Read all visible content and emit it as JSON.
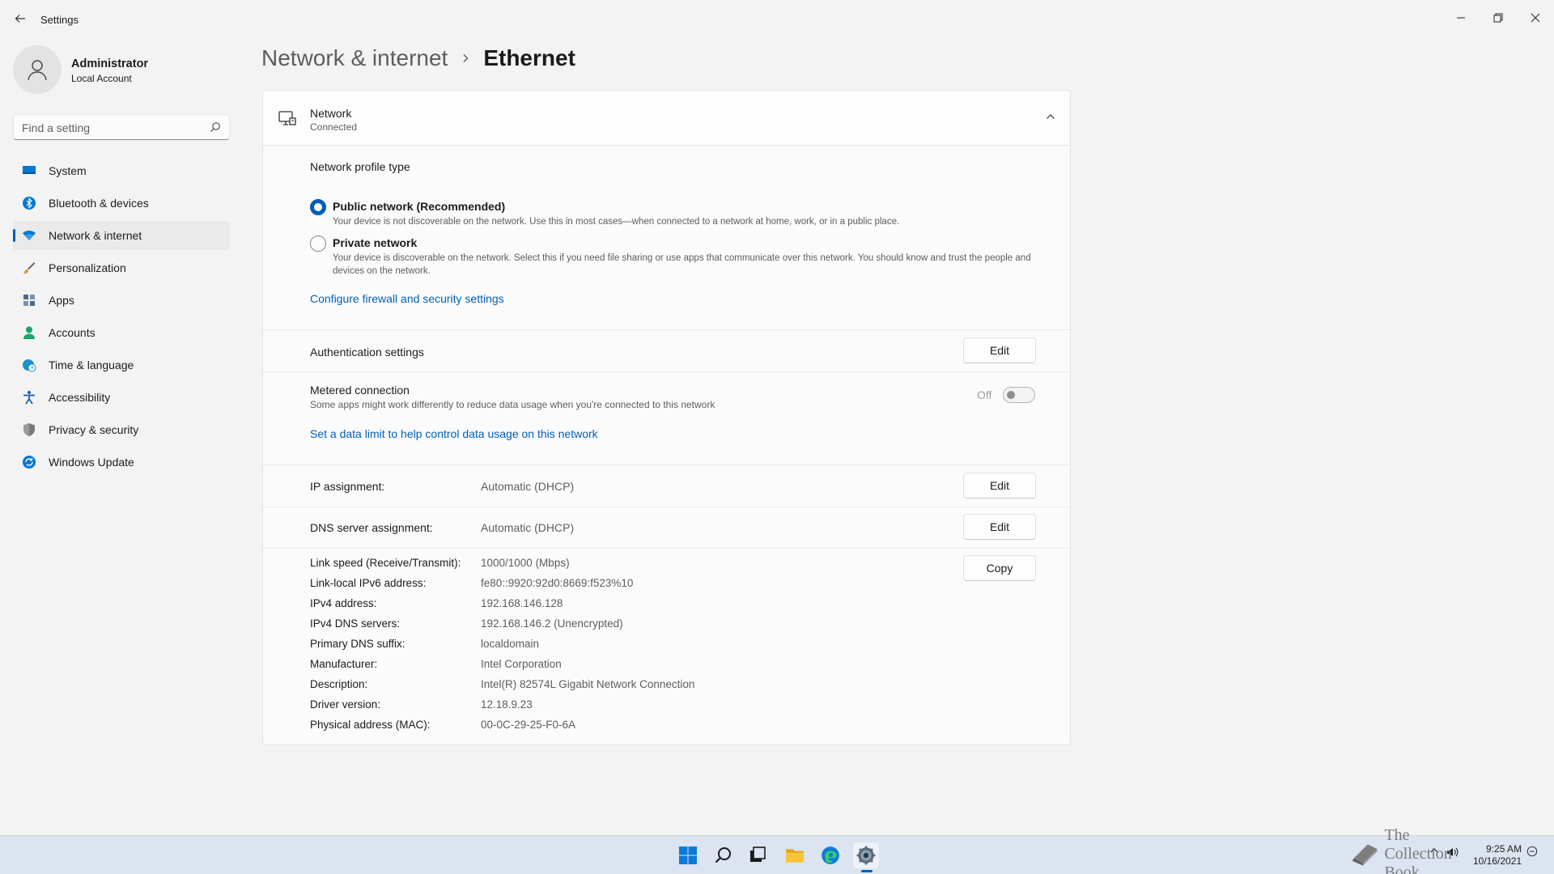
{
  "window": {
    "title": "Settings"
  },
  "profile": {
    "name": "Administrator",
    "account_type": "Local Account"
  },
  "search": {
    "placeholder": "Find a setting"
  },
  "sidebar": {
    "items": [
      {
        "label": "System",
        "icon": "system-icon",
        "color": "#0078d4"
      },
      {
        "label": "Bluetooth & devices",
        "icon": "bluetooth-icon",
        "color": "#0078d4"
      },
      {
        "label": "Network & internet",
        "icon": "wifi-icon",
        "color": "#0078d4",
        "active": true
      },
      {
        "label": "Personalization",
        "icon": "brush-icon",
        "color": "#e08a3c"
      },
      {
        "label": "Apps",
        "icon": "apps-icon",
        "color": "#4a6b8a"
      },
      {
        "label": "Accounts",
        "icon": "person-icon",
        "color": "#1aa36b"
      },
      {
        "label": "Time & language",
        "icon": "globe-clock-icon",
        "color": "#1e90c8"
      },
      {
        "label": "Accessibility",
        "icon": "accessibility-icon",
        "color": "#1f5fa8"
      },
      {
        "label": "Privacy & security",
        "icon": "shield-icon",
        "color": "#6b6b6b"
      },
      {
        "label": "Windows Update",
        "icon": "update-icon",
        "color": "#0078d4"
      }
    ]
  },
  "breadcrumb": {
    "parent": "Network & internet",
    "current": "Ethernet"
  },
  "network_card": {
    "title": "Network",
    "status": "Connected",
    "profile_type_heading": "Network profile type",
    "options": [
      {
        "label": "Public network (Recommended)",
        "description": "Your device is not discoverable on the network. Use this in most cases—when connected to a network at home, work, or in a public place.",
        "selected": true
      },
      {
        "label": "Private network",
        "description": "Your device is discoverable on the network. Select this if you need file sharing or use apps that communicate over this network. You should know and trust the people and devices on the network.",
        "selected": false
      }
    ],
    "firewall_link": "Configure firewall and security settings",
    "auth_label": "Authentication settings",
    "auth_button": "Edit",
    "metered_label": "Metered connection",
    "metered_desc": "Some apps might work differently to reduce data usage when you're connected to this network",
    "metered_state": "Off",
    "data_limit_link": "Set a data limit to help control data usage on this network",
    "ip_assignment_label": "IP assignment:",
    "ip_assignment_value": "Automatic (DHCP)",
    "ip_button": "Edit",
    "dns_assignment_label": "DNS server assignment:",
    "dns_assignment_value": "Automatic (DHCP)",
    "dns_button": "Edit",
    "copy_button": "Copy",
    "details": [
      {
        "label": "Link speed (Receive/Transmit):",
        "value": "1000/1000 (Mbps)"
      },
      {
        "label": "Link-local IPv6 address:",
        "value": "fe80::9920:92d0:8669:f523%10"
      },
      {
        "label": "IPv4 address:",
        "value": "192.168.146.128"
      },
      {
        "label": "IPv4 DNS servers:",
        "value": "192.168.146.2 (Unencrypted)"
      },
      {
        "label": "Primary DNS suffix:",
        "value": "localdomain"
      },
      {
        "label": "Manufacturer:",
        "value": "Intel Corporation"
      },
      {
        "label": "Description:",
        "value": "Intel(R) 82574L Gigabit Network Connection"
      },
      {
        "label": "Driver version:",
        "value": "12.18.9.23"
      },
      {
        "label": "Physical address (MAC):",
        "value": "00-0C-29-25-F0-6A"
      }
    ]
  },
  "taskbar": {
    "apps": [
      "start-icon",
      "search-icon",
      "task-view-icon",
      "file-explorer-icon",
      "edge-icon",
      "settings-icon"
    ],
    "time": "9:25 AM",
    "date": "10/16/2021",
    "watermark": "The Collection Book"
  },
  "colors": {
    "accent": "#005fb8",
    "background": "#f3f3f3",
    "card": "#fbfbfb"
  }
}
